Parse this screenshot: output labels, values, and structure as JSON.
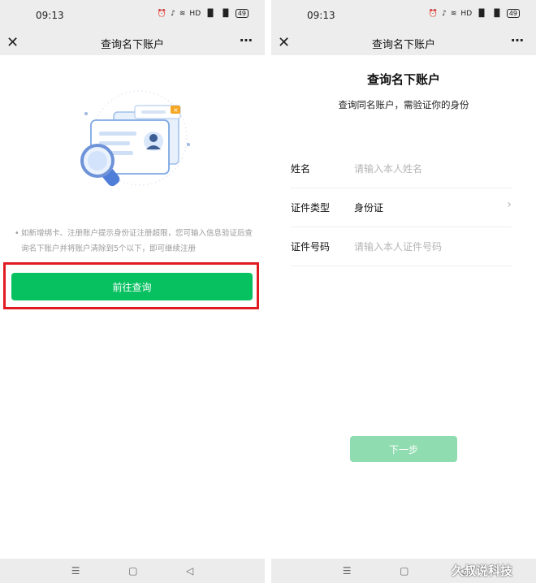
{
  "left": {
    "status": {
      "time": "09:13",
      "icons": [
        "alarm-icon",
        "mute-icon",
        "wifi-icon",
        "hd-icon",
        "signal-5g-icon",
        "signal-4g-icon",
        "battery-icon"
      ],
      "battery": "49"
    },
    "nav": {
      "close_icon": "close-icon",
      "title": "查询名下账户",
      "more_icon": "more-icon"
    },
    "notice": "如新增绑卡、注册账户提示身份证注册超限，您可输入信息验证后查询名下账户并将账户清除到5个以下，即可继续注册",
    "primary_button": "前往查询",
    "highlight_color": "#e11b22"
  },
  "right": {
    "status": {
      "time": "09:13",
      "battery": "49"
    },
    "nav": {
      "title": "查询名下账户"
    },
    "heading": "查询名下账户",
    "subheading": "查询同名账户，需验证你的身份",
    "form": {
      "name_label": "姓名",
      "name_placeholder": "请输入本人姓名",
      "idtype_label": "证件类型",
      "idtype_value": "身份证",
      "idnum_label": "证件号码",
      "idnum_placeholder": "请输入本人证件号码"
    },
    "next_button": "下一步"
  },
  "bottom_nav": {
    "icons": [
      "menu-icon",
      "home-icon",
      "back-icon"
    ]
  },
  "watermark": "久叔说科技",
  "colors": {
    "brand_green": "#07c160",
    "disabled_green": "#8fdcb0",
    "header_gray": "#ededed"
  }
}
